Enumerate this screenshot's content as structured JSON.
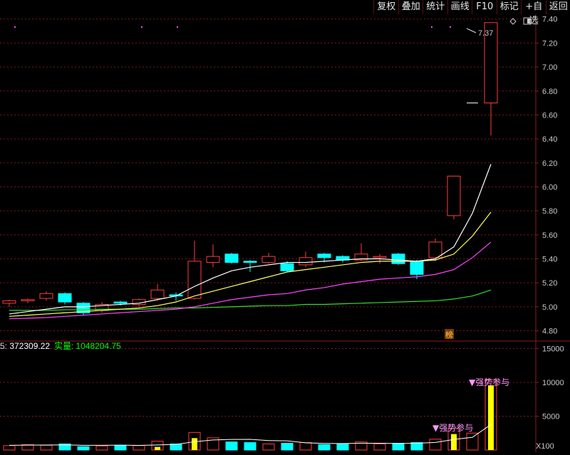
{
  "toolbar": {
    "buttons": [
      "复权",
      "叠加",
      "统计",
      "画线",
      "F10",
      "标记",
      "+自选",
      "返回"
    ]
  },
  "price_axis": {
    "ticks": [
      "7.40",
      "7.20",
      "7.00",
      "6.80",
      "6.60",
      "6.40",
      "6.20",
      "6.00",
      "5.80",
      "5.60",
      "5.40",
      "5.20",
      "5.00",
      "4.80"
    ]
  },
  "volume_axis": {
    "ticks": [
      "15000",
      "10000",
      "5000"
    ],
    "unit": "X100"
  },
  "labels": {
    "high_price": "7.37",
    "board_tag": "榜",
    "strong_signal_1": "▼强势参与",
    "strong_signal_2": "▼强势参与"
  },
  "volume_info": {
    "ma_prefix": "5: ",
    "ma_value": "372309.22",
    "actual_label": "实量:",
    "actual_value": "1048204.75"
  },
  "colors": {
    "up": "#ff3c3c",
    "down": "#00ffff",
    "ma5": "#ffffff",
    "ma10": "#ffff66",
    "ma20": "#ff44ff",
    "ma60": "#33dd33",
    "grid": "#7a1a1a"
  },
  "chart_data": {
    "type": "candlestick",
    "ylim": [
      4.72,
      7.44
    ],
    "candles": [
      {
        "o": 5.03,
        "c": 5.05,
        "h": 5.06,
        "l": 5.0
      },
      {
        "o": 5.05,
        "c": 5.06,
        "h": 5.07,
        "l": 5.03
      },
      {
        "o": 5.07,
        "c": 5.11,
        "h": 5.13,
        "l": 5.05
      },
      {
        "o": 5.11,
        "c": 5.04,
        "h": 5.12,
        "l": 5.02
      },
      {
        "o": 5.03,
        "c": 4.95,
        "h": 5.04,
        "l": 4.93
      },
      {
        "o": 4.97,
        "c": 5.02,
        "h": 5.04,
        "l": 4.95
      },
      {
        "o": 5.04,
        "c": 5.03,
        "h": 5.05,
        "l": 5.01
      },
      {
        "o": 5.02,
        "c": 5.06,
        "h": 5.07,
        "l": 5.0
      },
      {
        "o": 5.07,
        "c": 5.14,
        "h": 5.19,
        "l": 5.05
      },
      {
        "o": 5.1,
        "c": 5.09,
        "h": 5.12,
        "l": 5.05
      },
      {
        "o": 5.07,
        "c": 5.38,
        "h": 5.55,
        "l": 5.06
      },
      {
        "o": 5.37,
        "c": 5.42,
        "h": 5.52,
        "l": 5.33
      },
      {
        "o": 5.44,
        "c": 5.37,
        "h": 5.45,
        "l": 5.36
      },
      {
        "o": 5.38,
        "c": 5.37,
        "h": 5.39,
        "l": 5.29
      },
      {
        "o": 5.37,
        "c": 5.42,
        "h": 5.45,
        "l": 5.36
      },
      {
        "o": 5.36,
        "c": 5.3,
        "h": 5.38,
        "l": 5.29
      },
      {
        "o": 5.35,
        "c": 5.41,
        "h": 5.46,
        "l": 5.33
      },
      {
        "o": 5.44,
        "c": 5.41,
        "h": 5.45,
        "l": 5.37
      },
      {
        "o": 5.42,
        "c": 5.39,
        "h": 5.43,
        "l": 5.37
      },
      {
        "o": 5.39,
        "c": 5.44,
        "h": 5.53,
        "l": 5.38
      },
      {
        "o": 5.41,
        "c": 5.42,
        "h": 5.44,
        "l": 5.36
      },
      {
        "o": 5.44,
        "c": 5.36,
        "h": 5.45,
        "l": 5.35
      },
      {
        "o": 5.38,
        "c": 5.27,
        "h": 5.39,
        "l": 5.23
      },
      {
        "o": 5.41,
        "c": 5.54,
        "h": 5.57,
        "l": 5.38
      },
      {
        "o": 5.76,
        "c": 6.09,
        "h": 6.09,
        "l": 5.73
      },
      {
        "o": 6.7,
        "c": 6.7,
        "h": 6.7,
        "l": 6.7
      },
      {
        "o": 6.7,
        "c": 7.37,
        "h": 7.37,
        "l": 6.43
      }
    ],
    "ma5": [
      4.94,
      4.96,
      4.98,
      5.0,
      5.0,
      5.01,
      5.02,
      5.03,
      5.06,
      5.09,
      5.17,
      5.24,
      5.3,
      5.33,
      5.35,
      5.37,
      5.37,
      5.38,
      5.39,
      5.4,
      5.4,
      5.39,
      5.38,
      5.4,
      5.5,
      5.78,
      6.19
    ],
    "ma10": [
      4.92,
      4.93,
      4.94,
      4.95,
      4.96,
      4.97,
      4.98,
      4.99,
      5.01,
      5.04,
      5.09,
      5.13,
      5.17,
      5.21,
      5.25,
      5.29,
      5.31,
      5.33,
      5.35,
      5.37,
      5.38,
      5.38,
      5.38,
      5.39,
      5.44,
      5.59,
      5.79
    ],
    "ma20": [
      4.9,
      4.905,
      4.91,
      4.92,
      4.93,
      4.94,
      4.95,
      4.96,
      4.97,
      4.98,
      5.0,
      5.03,
      5.06,
      5.08,
      5.1,
      5.11,
      5.14,
      5.16,
      5.19,
      5.21,
      5.23,
      5.24,
      5.25,
      5.27,
      5.31,
      5.41,
      5.54
    ],
    "ma60": [
      4.97,
      4.97,
      4.97,
      4.975,
      4.975,
      4.98,
      4.98,
      4.98,
      4.985,
      4.99,
      4.99,
      4.995,
      5.0,
      5.005,
      5.01,
      5.01,
      5.02,
      5.02,
      5.025,
      5.03,
      5.035,
      5.04,
      5.045,
      5.05,
      5.065,
      5.09,
      5.14
    ],
    "volume": {
      "ylim": [
        0,
        16000
      ],
      "values": [
        650,
        800,
        700,
        900,
        500,
        600,
        700,
        650,
        1300,
        900,
        2600,
        1800,
        1200,
        1100,
        900,
        1000,
        1100,
        800,
        900,
        1200,
        900,
        1000,
        1100,
        1600,
        3200,
        2500,
        10400
      ],
      "highlight": [
        0,
        0,
        0,
        0,
        0,
        0,
        0,
        0,
        1,
        0,
        1,
        0,
        0,
        0,
        0,
        0,
        0,
        0,
        0,
        0,
        0,
        0,
        0,
        0,
        1,
        0,
        1
      ],
      "ma5": [
        700,
        720,
        740,
        760,
        700,
        700,
        720,
        690,
        750,
        830,
        1230,
        1490,
        1560,
        1580,
        1400,
        1360,
        1060,
        980,
        960,
        1000,
        1000,
        960,
        1000,
        1120,
        1560,
        1880,
        3760
      ]
    }
  }
}
